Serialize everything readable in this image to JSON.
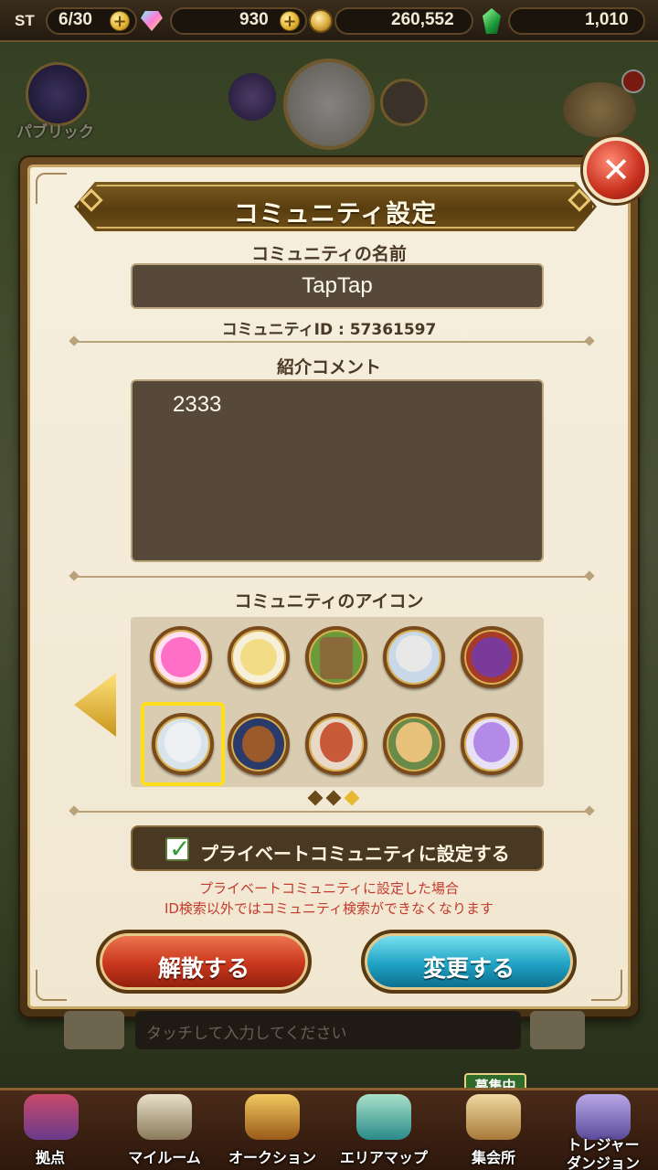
{
  "status_bar": {
    "stamina_label": "ST",
    "stamina_value": "6/30",
    "gems_value": "930",
    "gold_value": "260,552",
    "green_value": "1,010"
  },
  "background_header": {
    "left_label": "パブリック"
  },
  "dialog": {
    "title": "コミュニティ設定",
    "name_label": "コミュニティの名前",
    "name_value": "TapTap",
    "community_id": "コミュニティID : 57361597",
    "comment_label": "紹介コメント",
    "comment_value": "2333",
    "icon_label": "コミュニティのアイコン",
    "icons": [
      {
        "name": "pink-blob",
        "color": "#ff6fc8"
      },
      {
        "name": "cream-creature",
        "color": "#f3dc86"
      },
      {
        "name": "tree-stump",
        "color": "#8a6a3a"
      },
      {
        "name": "skull-knight",
        "color": "#e8e8e8"
      },
      {
        "name": "purple-dragon",
        "color": "#7a3a9a"
      },
      {
        "name": "white-hair-girl",
        "color": "#eef0f4"
      },
      {
        "name": "tanuki",
        "color": "#9a5a2a"
      },
      {
        "name": "red-warrior",
        "color": "#c85a3a"
      },
      {
        "name": "blonde-adventurer",
        "color": "#e8c27a"
      },
      {
        "name": "purple-hair-girl",
        "color": "#b48ae8"
      }
    ],
    "selected_icon_index": 5,
    "icon_pages": 3,
    "active_page": 2,
    "private_label": "プライベートコミュニティに設定する",
    "private_checked": true,
    "warning_line1": "プライベートコミュニティに設定した場合",
    "warning_line2": "ID検索以外ではコミュニティ検索ができなくなります",
    "disband_label": "解散する",
    "change_label": "変更する"
  },
  "chat": {
    "placeholder": "タッチして入力してください"
  },
  "bottom_nav": {
    "recruit_badge": "募集中",
    "items": [
      {
        "label": "拠点"
      },
      {
        "label": "マイルーム"
      },
      {
        "label": "オークション"
      },
      {
        "label": "エリアマップ"
      },
      {
        "label": "集会所"
      },
      {
        "label": "トレジャー"
      },
      {
        "label": "ダンジョン"
      }
    ]
  },
  "colors": {
    "accent_gold": "#e8b830",
    "button_red": "#c8361c",
    "button_teal": "#1fa2c4",
    "warning_red": "#c43a2c"
  }
}
